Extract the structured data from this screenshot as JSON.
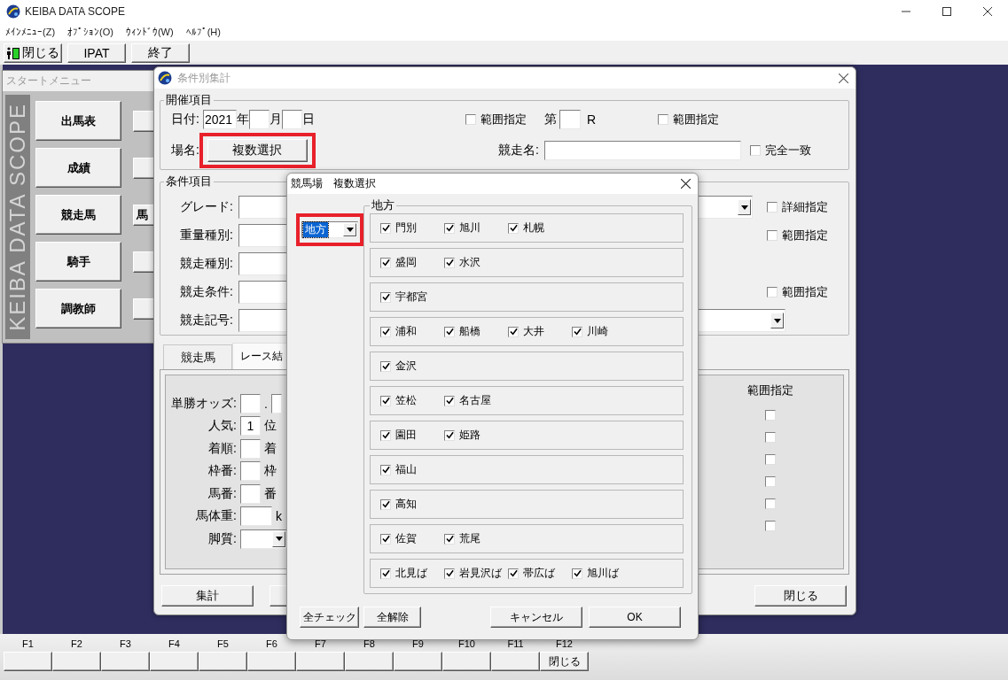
{
  "window": {
    "title": "KEIBA DATA SCOPE"
  },
  "menu": [
    "ﾒｲﾝﾒﾆｭｰ(Z)",
    "ｵﾌﾟｼｮﾝ(O)",
    "ｳｨﾝﾄﾞｳ(W)",
    "ﾍﾙﾌﾟ(H)"
  ],
  "toolbar": [
    {
      "label": "閉じる",
      "kind": "exit"
    },
    {
      "label": "IPAT",
      "kind": "plain"
    },
    {
      "label": "終了",
      "kind": "plain"
    }
  ],
  "start_menu": {
    "title": "スタートメニュー",
    "brand": "KEIBA DATA SCOPE",
    "buttons": [
      "出馬表",
      "成績",
      "競走馬",
      "騎手",
      "調教師"
    ],
    "second_column_label": "馬"
  },
  "summary_window": {
    "title": "条件別集計",
    "event_group": {
      "title": "開催項目",
      "date_label": "日付:",
      "year": "2021",
      "year_unit": "年",
      "month_unit": "月",
      "day_unit": "日",
      "date_range": {
        "label": "範囲指定",
        "checked": false
      },
      "race_prefix": "第",
      "race_unit": "R",
      "race_range": {
        "label": "範囲指定",
        "checked": false
      },
      "venue_label": "場名:",
      "venue_button": "複数選択",
      "race_name_label": "競走名:",
      "exact_match": {
        "label": "完全一致",
        "checked": false
      }
    },
    "condition_group": {
      "title": "条件項目",
      "rows": [
        {
          "label": "グレード:",
          "kind": "combo",
          "option": {
            "label": "詳細指定",
            "checked": false
          }
        },
        {
          "label": "重量種別:",
          "kind": "text",
          "option": {
            "label": "範囲指定",
            "checked": false
          }
        },
        {
          "label": "競走種別:",
          "kind": "text"
        },
        {
          "label": "競走条件:",
          "kind": "text",
          "option": {
            "label": "範囲指定",
            "checked": false
          }
        },
        {
          "label": "競走記号:",
          "kind": "wide-combo"
        }
      ]
    },
    "tabs": [
      {
        "label": "競走馬",
        "selected": false
      },
      {
        "label": "レース結",
        "selected": true
      }
    ],
    "result_fields": [
      {
        "label": "単勝オッズ:",
        "kind": "odds",
        "separator": "."
      },
      {
        "label": "人気:",
        "kind": "unit",
        "value": "1",
        "unit": "位"
      },
      {
        "label": "着順:",
        "kind": "unit",
        "unit": "着"
      },
      {
        "label": "枠番:",
        "kind": "unit",
        "unit": "枠"
      },
      {
        "label": "馬番:",
        "kind": "unit",
        "unit": "番"
      },
      {
        "label": "馬体重:",
        "kind": "wide",
        "unit": "k"
      },
      {
        "label": "脚質:",
        "kind": "combo"
      }
    ],
    "range_header": "範囲指定",
    "range_checks": [
      {
        "checked": false
      },
      {
        "checked": false
      },
      {
        "checked": false
      },
      {
        "checked": false
      },
      {
        "checked": false
      },
      {
        "checked": false
      }
    ],
    "buttons": [
      "集計",
      "閉じる"
    ]
  },
  "venue_dialog": {
    "title": "競馬場　複数選択",
    "region": "地方",
    "group_title": "地方",
    "rows": [
      [
        {
          "label": "門別",
          "checked": true
        },
        {
          "label": "旭川",
          "checked": true
        },
        {
          "label": "札幌",
          "checked": true
        }
      ],
      [
        {
          "label": "盛岡",
          "checked": true
        },
        {
          "label": "水沢",
          "checked": true
        }
      ],
      [
        {
          "label": "宇都宮",
          "checked": true
        }
      ],
      [
        {
          "label": "浦和",
          "checked": true
        },
        {
          "label": "船橋",
          "checked": true
        },
        {
          "label": "大井",
          "checked": true
        },
        {
          "label": "川崎",
          "checked": true
        }
      ],
      [
        {
          "label": "金沢",
          "checked": true
        }
      ],
      [
        {
          "label": "笠松",
          "checked": true
        },
        {
          "label": "名古屋",
          "checked": true
        }
      ],
      [
        {
          "label": "園田",
          "checked": true
        },
        {
          "label": "姫路",
          "checked": true
        }
      ],
      [
        {
          "label": "福山",
          "checked": true
        }
      ],
      [
        {
          "label": "高知",
          "checked": true
        }
      ],
      [
        {
          "label": "佐賀",
          "checked": true
        },
        {
          "label": "荒尾",
          "checked": true
        }
      ],
      [
        {
          "label": "北見ば",
          "checked": true
        },
        {
          "label": "岩見沢ば",
          "checked": true
        },
        {
          "label": "帯広ば",
          "checked": true
        },
        {
          "label": "旭川ば",
          "checked": true
        }
      ]
    ],
    "buttons": [
      "全チェック",
      "全解除",
      "キャンセル",
      "OK"
    ]
  },
  "fkeys": [
    {
      "key": "F1"
    },
    {
      "key": "F2"
    },
    {
      "key": "F3"
    },
    {
      "key": "F4"
    },
    {
      "key": "F5"
    },
    {
      "key": "F6"
    },
    {
      "key": "F7"
    },
    {
      "key": "F8"
    },
    {
      "key": "F9"
    },
    {
      "key": "F10"
    },
    {
      "key": "F11"
    },
    {
      "key": "F12",
      "label": "閉じる"
    }
  ]
}
